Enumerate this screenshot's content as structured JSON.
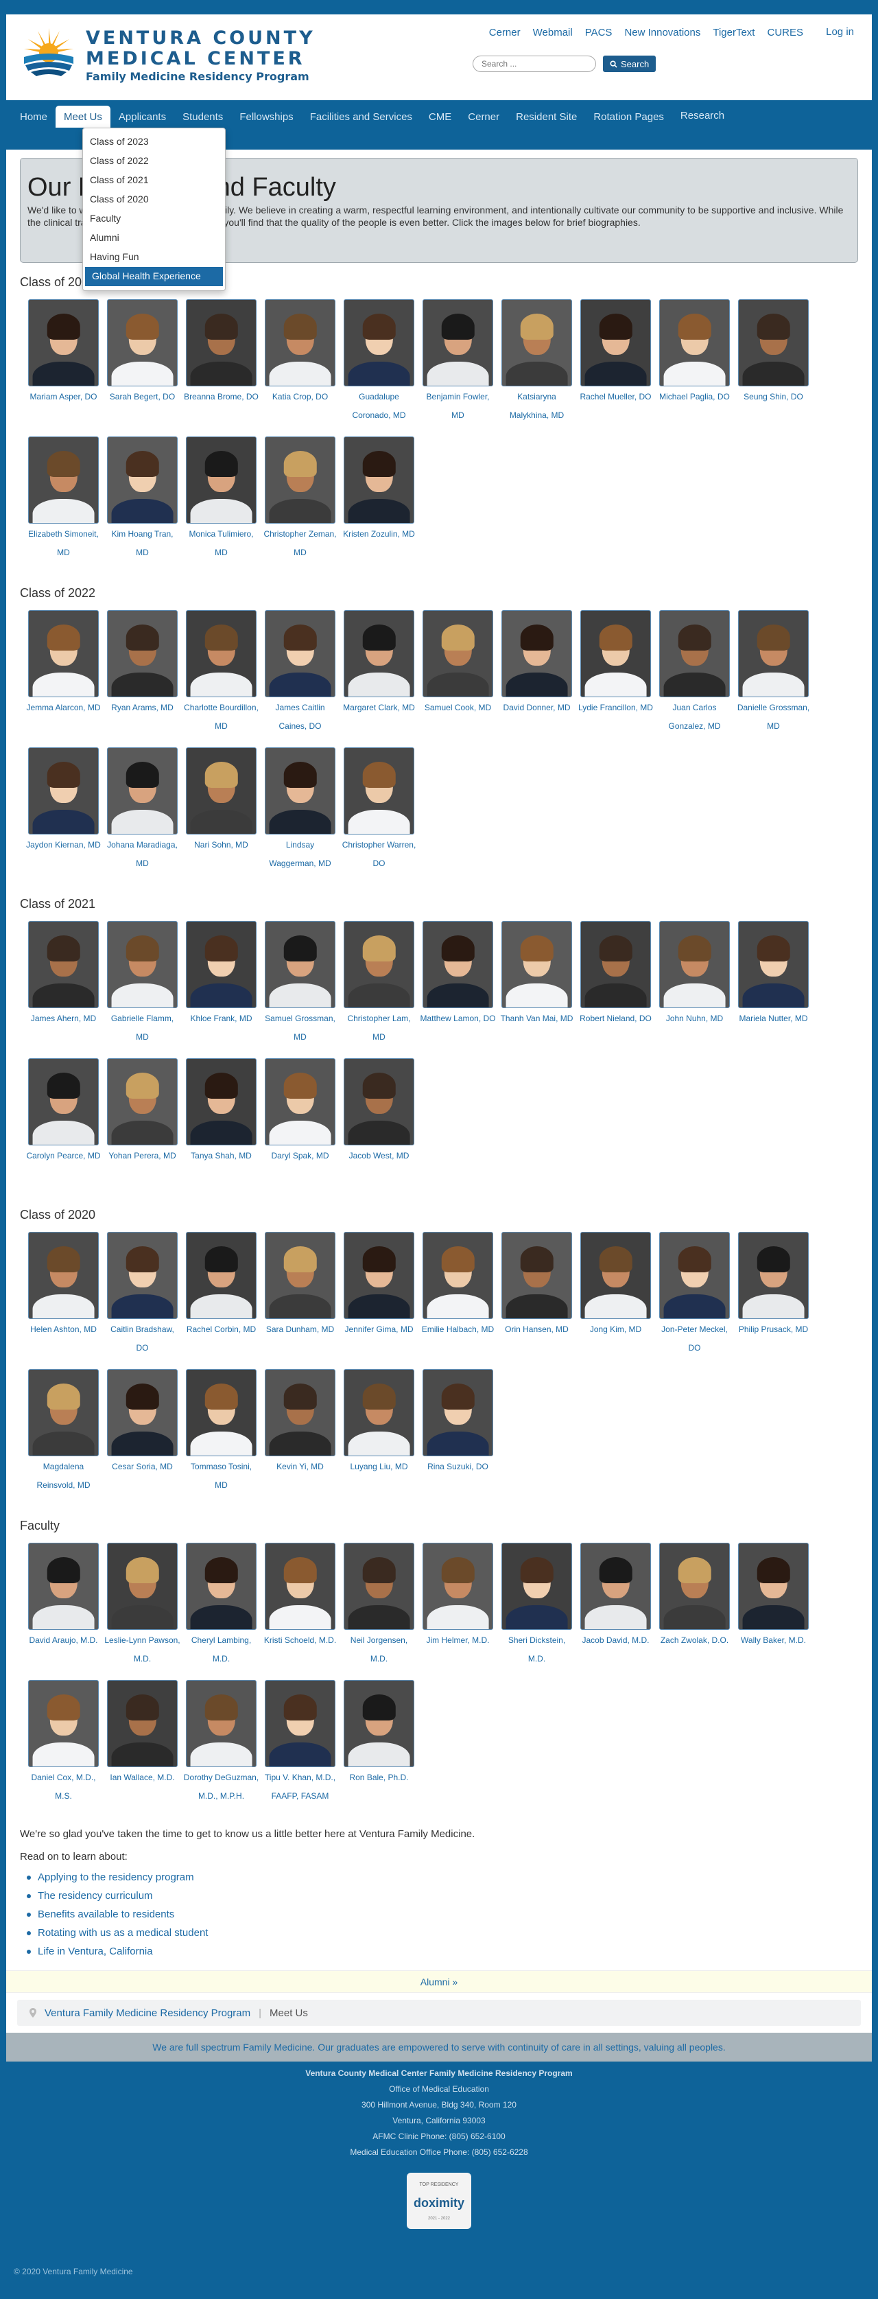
{
  "header": {
    "logo_line1": "VENTURA COUNTY",
    "logo_line2": "MEDICAL CENTER",
    "logo_line3": "Family Medicine Residency Program",
    "toplinks": [
      "Cerner",
      "Webmail",
      "PACS",
      "New Innovations",
      "TigerText",
      "CURES"
    ],
    "login": "Log in",
    "search_placeholder": "Search ...",
    "search_button": "Search"
  },
  "nav": {
    "items": [
      "Home",
      "Meet Us",
      "Applicants",
      "Students",
      "Fellowships",
      "Facilities and Services",
      "CME",
      "Cerner",
      "Resident Site",
      "Rotation Pages"
    ],
    "items_row2": [
      "Research"
    ]
  },
  "dropdown": [
    "Class of 2023",
    "Class of 2022",
    "Class of 2021",
    "Class of 2020",
    "Faculty",
    "Alumni",
    "Having Fun",
    "Global Health Experience"
  ],
  "intro": {
    "title": "Our Residents and Faculty",
    "text": "We'd like to welcome you to our residency family.  We believe in creating a warm, respectful learning environment, and intentionally cultivate our community to be supportive and inclusive. While the clinical training here is top-notch, we think you'll find that the quality of the people is even better.  Click the images below for brief biographies."
  },
  "sections": [
    {
      "title": "Class of 2023",
      "people": [
        "Mariam Asper, DO",
        "Sarah Begert, DO",
        "Breanna Brome, DO",
        "Katia Crop, DO",
        "Guadalupe Coronado, MD",
        "Benjamin Fowler, MD",
        "Katsiaryna Malykhina, MD",
        "Rachel Mueller, DO",
        "Michael Paglia, DO",
        "Seung Shin, DO",
        "Elizabeth Simoneit, MD",
        "Kim Hoang Tran, MD",
        "Monica Tulimiero, MD",
        "Christopher Zeman, MD",
        "Kristen Zozulin, MD"
      ]
    },
    {
      "title": "Class of 2022",
      "people": [
        "Jemma Alarcon, MD",
        "Ryan Arams, MD",
        "Charlotte Bourdillon, MD",
        "James Caitlin Caines, DO",
        "Margaret Clark, MD",
        "Samuel Cook, MD",
        "David Donner, MD",
        "Lydie Francillon, MD",
        "Juan Carlos Gonzalez, MD",
        "Danielle Grossman, MD",
        "Jaydon Kiernan, MD",
        "Johana Maradiaga, MD",
        "Nari Sohn, MD",
        "Lindsay Waggerman, MD",
        "Christopher Warren, DO"
      ]
    },
    {
      "title": "Class of 2021",
      "people": [
        "James Ahern, MD",
        "Gabrielle Flamm, MD",
        "Khloe Frank, MD",
        "Samuel Grossman, MD",
        "Christopher Lam, MD",
        "Matthew Lamon, DO",
        "Thanh Van Mai, MD",
        "Robert Nieland, DO",
        "John Nuhn, MD",
        "Mariela Nutter, MD",
        "Carolyn Pearce, MD",
        "Yohan Perera, MD",
        "Tanya Shah, MD",
        "Daryl Spak, MD",
        "Jacob West, MD"
      ]
    },
    {
      "title": "Class of 2020",
      "people": [
        "Helen Ashton, MD",
        "Caitlin Bradshaw, DO",
        "Rachel Corbin, MD",
        "Sara Dunham, MD",
        "Jennifer Gima, MD",
        "Emilie Halbach, MD",
        "Orin Hansen, MD",
        "Jong Kim, MD",
        "Jon-Peter Meckel, DO",
        "Philip Prusack, MD",
        "Magdalena Reinsvold, MD",
        "Cesar Soria, MD",
        "Tommaso Tosini, MD",
        "Kevin Yi, MD",
        "Luyang Liu, MD",
        "Rina Suzuki, DO"
      ]
    },
    {
      "title": "Faculty",
      "people": [
        "David Araujo, M.D.",
        "Leslie-Lynn Pawson, M.D.",
        "Cheryl Lambing, M.D.",
        "Kristi Schoeld, M.D.",
        "Neil Jorgensen, M.D.",
        "Jim Helmer, M.D.",
        "Sheri Dickstein, M.D.",
        "Jacob David, M.D.",
        "Zach Zwolak, D.O.",
        "Wally Baker, M.D.",
        "Daniel Cox, M.D., M.S.",
        "Ian Wallace, M.D.",
        "Dorothy DeGuzman, M.D., M.P.H.",
        "Tipu V. Khan, M.D., FAAFP, FASAM",
        "Ron Bale, Ph.D."
      ]
    }
  ],
  "outro": {
    "text": "We're so glad you've taken the time to get to know us a little better here at Ventura Family Medicine.",
    "read_on": "Read on to learn about:",
    "links": [
      "Applying to the residency program",
      "The residency curriculum",
      "Benefits available to residents",
      "Rotating with us as a medical student",
      "Life in Ventura, California"
    ]
  },
  "alumni_link": "Alumni »",
  "breadcrumb": {
    "link": "Ventura Family Medicine Residency Program",
    "current": "Meet Us"
  },
  "tagline": "We are full spectrum Family Medicine. Our graduates are empowered to serve with continuity of care in all settings, valuing all peoples.",
  "footer": {
    "title": "Ventura County Medical Center Family Medicine Residency Program",
    "lines": [
      "Office of Medical Education",
      "300 Hillmont Avenue, Bldg 340, Room 120",
      "Ventura, California 93003",
      "AFMC Clinic Phone: (805) 652-6100",
      "Medical Education Office Phone: (805) 652-6228"
    ],
    "badge_top": "TOP RESIDENCY",
    "badge_name": "doximity",
    "badge_year": "2021 - 2022"
  },
  "copyright": "© 2020 Ventura Family Medicine",
  "colors": {
    "brand": "#0e6399",
    "link": "#1c6aa5",
    "logo": "#1d5d8e"
  }
}
